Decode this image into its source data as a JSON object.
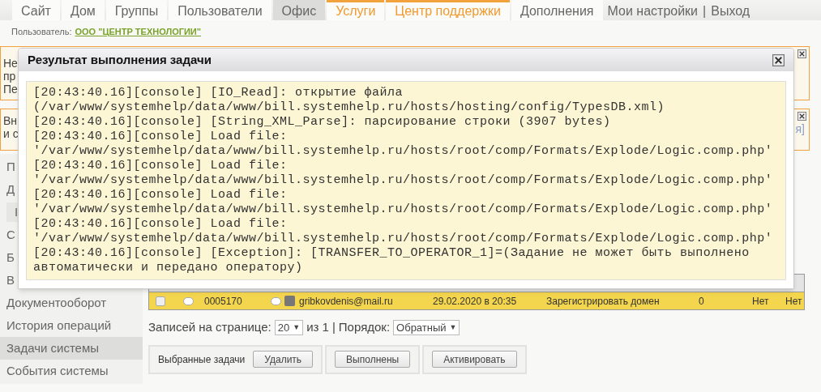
{
  "nav": {
    "tabs": [
      {
        "label": "Сайт",
        "selected": false,
        "highlighted": false
      },
      {
        "label": "Дом",
        "selected": false,
        "highlighted": false
      },
      {
        "label": "Группы",
        "selected": false,
        "highlighted": false
      },
      {
        "label": "Пользователи",
        "selected": false,
        "highlighted": false
      },
      {
        "label": "Офис",
        "selected": true,
        "highlighted": false
      },
      {
        "label": "Услуги",
        "selected": false,
        "highlighted": true
      },
      {
        "label": "Центр поддержки",
        "selected": false,
        "highlighted": true
      },
      {
        "label": "Дополнения",
        "selected": false,
        "highlighted": false
      }
    ],
    "links": [
      "Мои настройки",
      "Выход"
    ],
    "separator": "|"
  },
  "user": {
    "label": "Пользователь:",
    "name": "ООО \"ЦЕНТР ТЕХНОЛОГИИ\""
  },
  "notices": [
    {
      "lines": [
        "Не",
        "пр",
        "Пе"
      ]
    },
    {
      "lines": [
        "Вн",
        "и с"
      ],
      "right_text": "я]"
    }
  ],
  "sidebar": {
    "items": [
      {
        "label": "П",
        "kind": "item"
      },
      {
        "label": "Д",
        "kind": "item"
      },
      {
        "label": "I",
        "kind": "sub"
      },
      {
        "label": "С",
        "kind": "item"
      },
      {
        "label": "Б",
        "kind": "item"
      },
      {
        "label": "В",
        "kind": "item"
      },
      {
        "label": "Документооборот",
        "selected": false,
        "kind": "item"
      },
      {
        "label": "История операций",
        "selected": false,
        "kind": "item"
      },
      {
        "label": "Задачи системы",
        "selected": true,
        "kind": "item"
      },
      {
        "label": "События системы",
        "selected": false,
        "kind": "item"
      }
    ]
  },
  "table": {
    "rows": [
      {
        "checked": false,
        "number": "0005170",
        "user": "gribkovdenis@mail.ru",
        "date": "29.02.2020 в 20:35",
        "task": "Зарегистрировать домен",
        "errors": "0",
        "col_7": "Нет",
        "col_8": "Нет"
      }
    ]
  },
  "pagination": {
    "caret": "▼",
    "label": "Записей на странице:",
    "per_page": "20",
    "of": "из 1",
    "separator": "|",
    "order_label": "Порядок:",
    "order": "Обратный"
  },
  "actions": {
    "label": "Выбранные задачи",
    "buttons": [
      "Удалить",
      "Выполнены",
      "Активировать"
    ]
  },
  "dialog": {
    "title": "Результат выполнения задачи",
    "log_lines": [
      "[20:43:40.16][console] [IO_Read]: открытие файла",
      "(/var/www/systemhelp/data/www/bill.systemhelp.ru/hosts/hosting/config/TypesDB.xml)",
      "[20:43:40.16][console] [String_XML_Parse]: парсирование строки (3907 bytes)",
      "[20:43:40.16][console] Load file:",
      "'/var/www/systemhelp/data/www/bill.systemhelp.ru/hosts/root/comp/Formats/Explode/Logic.comp.php'",
      "[20:43:40.16][console] Load file:",
      "'/var/www/systemhelp/data/www/bill.systemhelp.ru/hosts/root/comp/Formats/Explode/Logic.comp.php'",
      "[20:43:40.16][console] Load file:",
      "'/var/www/systemhelp/data/www/bill.systemhelp.ru/hosts/root/comp/Formats/Explode/Logic.comp.php'",
      "[20:43:40.16][console] Load file:",
      "'/var/www/systemhelp/data/www/bill.systemhelp.ru/hosts/root/comp/Formats/Explode/Logic.comp.php'",
      "[20:43:40.16][console] [Exception]: [TRANSFER_TO_OPERATOR_1]=(Задание не может быть выполнено",
      "автоматически и передано оператору)"
    ]
  }
}
